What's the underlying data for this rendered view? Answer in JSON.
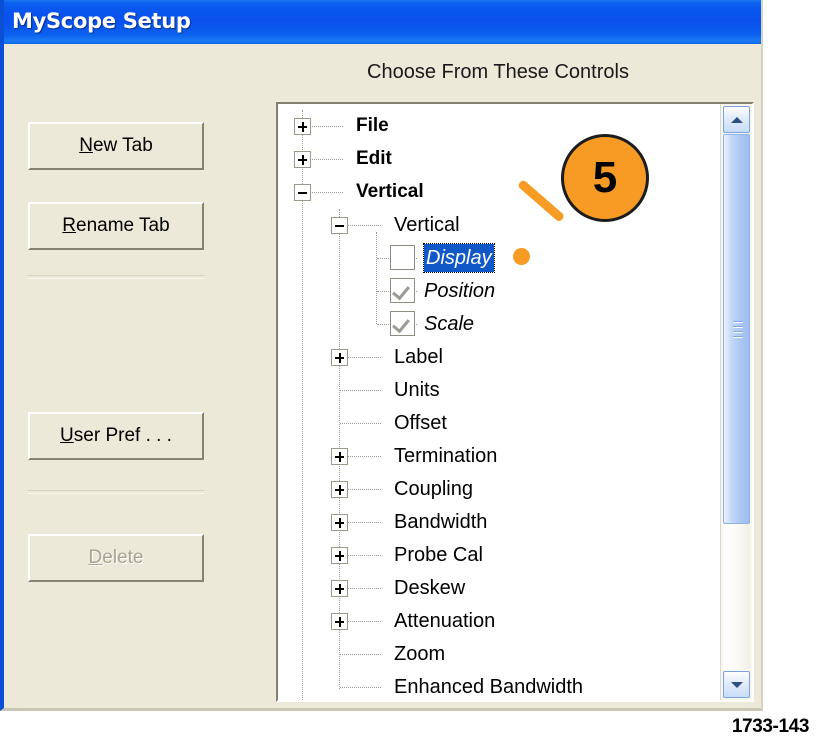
{
  "window": {
    "title": "MyScope Setup"
  },
  "header": {
    "choose_label": "Choose From These Controls"
  },
  "buttons": [
    {
      "name": "new-tab",
      "label": "New Tab",
      "accel": "N",
      "before": "",
      "after": "ew Tab",
      "disabled": false
    },
    {
      "name": "rename-tab",
      "label": "Rename Tab",
      "accel": "R",
      "before": "",
      "after": "ename Tab",
      "disabled": false
    },
    {
      "name": "user-pref",
      "label": "User Pref . . .",
      "accel": "U",
      "before": "",
      "after": "ser Pref . . .",
      "disabled": false
    },
    {
      "name": "delete",
      "label": "Delete",
      "accel": "D",
      "before": "",
      "after": "elete",
      "disabled": true
    }
  ],
  "tree": {
    "nodes": [
      {
        "label": "File",
        "level": 0,
        "expander": "plus",
        "bold": true,
        "italic": false,
        "checkbox": "none",
        "selected": false
      },
      {
        "label": "Edit",
        "level": 0,
        "expander": "plus",
        "bold": true,
        "italic": false,
        "checkbox": "none",
        "selected": false
      },
      {
        "label": "Vertical",
        "level": 0,
        "expander": "minus",
        "bold": true,
        "italic": false,
        "checkbox": "none",
        "selected": false
      },
      {
        "label": "Vertical",
        "level": 1,
        "expander": "minus",
        "bold": false,
        "italic": false,
        "checkbox": "none",
        "selected": false
      },
      {
        "label": "Display",
        "level": 2,
        "expander": "none",
        "bold": false,
        "italic": true,
        "checkbox": "unchecked",
        "selected": true
      },
      {
        "label": "Position",
        "level": 2,
        "expander": "none",
        "bold": false,
        "italic": true,
        "checkbox": "checked",
        "selected": false
      },
      {
        "label": "Scale",
        "level": 2,
        "expander": "none",
        "bold": false,
        "italic": true,
        "checkbox": "checked",
        "selected": false
      },
      {
        "label": "Label",
        "level": 1,
        "expander": "plus",
        "bold": false,
        "italic": false,
        "checkbox": "none",
        "selected": false
      },
      {
        "label": "Units",
        "level": 1,
        "expander": "none",
        "bold": false,
        "italic": false,
        "checkbox": "none",
        "selected": false
      },
      {
        "label": "Offset",
        "level": 1,
        "expander": "none",
        "bold": false,
        "italic": false,
        "checkbox": "none",
        "selected": false
      },
      {
        "label": "Termination",
        "level": 1,
        "expander": "plus",
        "bold": false,
        "italic": false,
        "checkbox": "none",
        "selected": false
      },
      {
        "label": "Coupling",
        "level": 1,
        "expander": "plus",
        "bold": false,
        "italic": false,
        "checkbox": "none",
        "selected": false
      },
      {
        "label": "Bandwidth",
        "level": 1,
        "expander": "plus",
        "bold": false,
        "italic": false,
        "checkbox": "none",
        "selected": false
      },
      {
        "label": "Probe Cal",
        "level": 1,
        "expander": "plus",
        "bold": false,
        "italic": false,
        "checkbox": "none",
        "selected": false
      },
      {
        "label": "Deskew",
        "level": 1,
        "expander": "plus",
        "bold": false,
        "italic": false,
        "checkbox": "none",
        "selected": false
      },
      {
        "label": "Attenuation",
        "level": 1,
        "expander": "plus",
        "bold": false,
        "italic": false,
        "checkbox": "none",
        "selected": false
      },
      {
        "label": "Zoom",
        "level": 1,
        "expander": "none",
        "bold": false,
        "italic": false,
        "checkbox": "none",
        "selected": false
      },
      {
        "label": "Enhanced Bandwidth",
        "level": 1,
        "expander": "none",
        "bold": false,
        "italic": false,
        "checkbox": "none",
        "selected": false
      }
    ]
  },
  "scrollbar": {
    "up_arrow_icon": "chevron-up-icon",
    "down_arrow_icon": "chevron-down-icon",
    "grip_icon": "scrollbar-grip-icon"
  },
  "callout": {
    "number": "5"
  },
  "figure": {
    "number": "1733-143"
  },
  "colors": {
    "titlebar_blue": "#0a58ef",
    "window_face": "#ece9d8",
    "selection_blue": "#1058c8",
    "callout_orange": "#f79b24",
    "scrollbar_blue": "#a8c6f3"
  }
}
